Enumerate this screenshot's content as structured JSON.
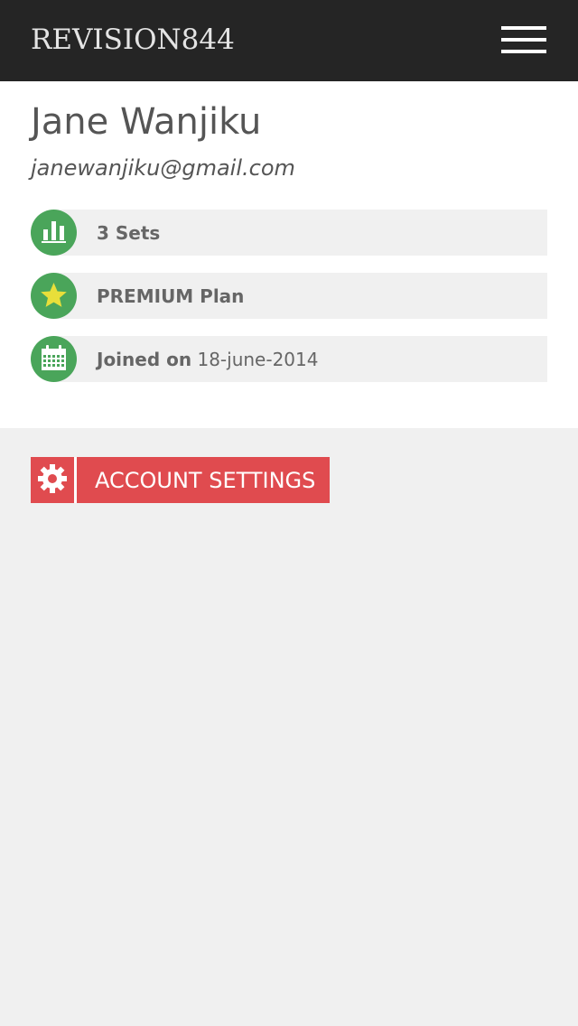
{
  "header": {
    "brand": "REVISION844",
    "menu_icon": "hamburger-menu-icon"
  },
  "profile": {
    "name": "Jane Wanjiku",
    "email": "janewanjiku@gmail.com",
    "stats": [
      {
        "icon": "bar-chart-icon",
        "bold_text": "3 Sets",
        "regular_text": ""
      },
      {
        "icon": "star-icon",
        "bold_text": "PREMIUM Plan",
        "regular_text": ""
      },
      {
        "icon": "calendar-icon",
        "bold_text": "Joined on",
        "regular_text": "18-june-2014"
      }
    ]
  },
  "account_settings": {
    "label": "ACCOUNT SETTINGS",
    "icon": "gear-icon"
  },
  "colors": {
    "header_bg": "#252525",
    "accent_green": "#4aa55a",
    "accent_red": "#e04b4f",
    "star_yellow": "#e8df3a"
  }
}
